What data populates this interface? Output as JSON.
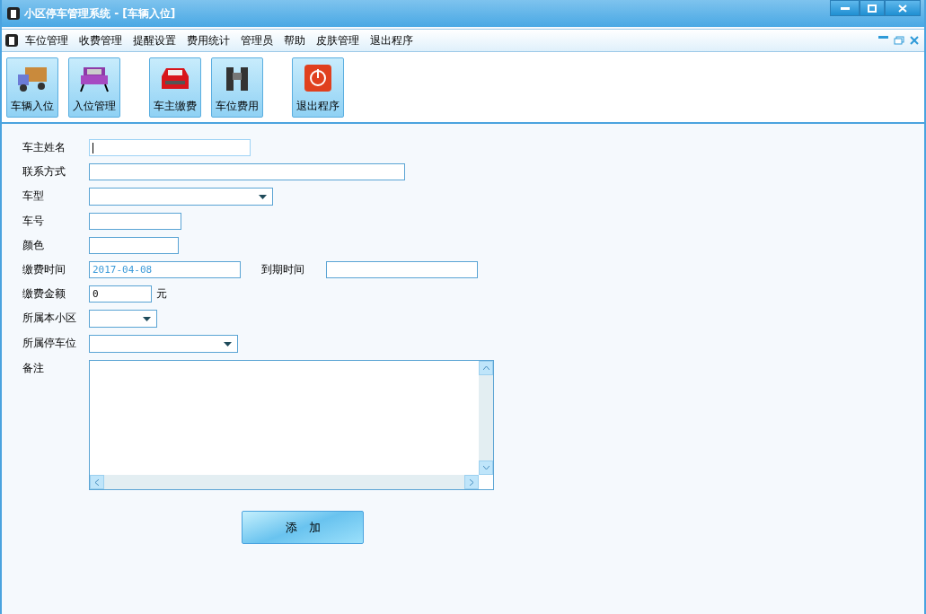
{
  "window": {
    "title": "小区停车管理系统 - [车辆入位]"
  },
  "menu": [
    "车位管理",
    "收费管理",
    "提醒设置",
    "费用统计",
    "管理员",
    "帮助",
    "皮肤管理",
    "退出程序"
  ],
  "toolbar": [
    [
      {
        "label": "车辆入位",
        "kind": "truck"
      },
      {
        "label": "入位管理",
        "kind": "car-front"
      }
    ],
    [
      {
        "label": "车主缴费",
        "kind": "red-car"
      },
      {
        "label": "车位费用",
        "kind": "binoculars"
      }
    ],
    [
      {
        "label": "退出程序",
        "kind": "power"
      }
    ]
  ],
  "form": [
    {
      "label": "车主姓名",
      "fields": [
        {
          "kind": "text",
          "focused": true
        }
      ]
    },
    {
      "label": "联系方式",
      "fields": [
        {
          "kind": "text",
          "focused": false
        }
      ]
    },
    {
      "label": "车型",
      "fields": [
        {
          "kind": "select"
        }
      ]
    },
    {
      "label": "车号",
      "fields": [
        {
          "kind": "text",
          "focused": false
        }
      ]
    },
    {
      "label": "颜色",
      "fields": [
        {
          "kind": "text",
          "focused": false
        }
      ]
    },
    {
      "label": "缴费时间",
      "fields": [
        {
          "kind": "date",
          "value": "2017-04-08"
        },
        {
          "kind": "date",
          "label": "到期时间"
        }
      ]
    },
    {
      "label": "缴费金额",
      "fields": [
        {
          "kind": "text",
          "value": "0",
          "focused": false
        }
      ],
      "unit": "元"
    },
    {
      "label": "所属本小区",
      "fields": [
        {
          "kind": "select"
        }
      ]
    },
    {
      "label": "所属停车位",
      "fields": [
        {
          "kind": "select"
        }
      ]
    },
    {
      "label": "备注",
      "fields": [
        {
          "kind": "textarea"
        }
      ]
    }
  ],
  "submit": "添　加"
}
